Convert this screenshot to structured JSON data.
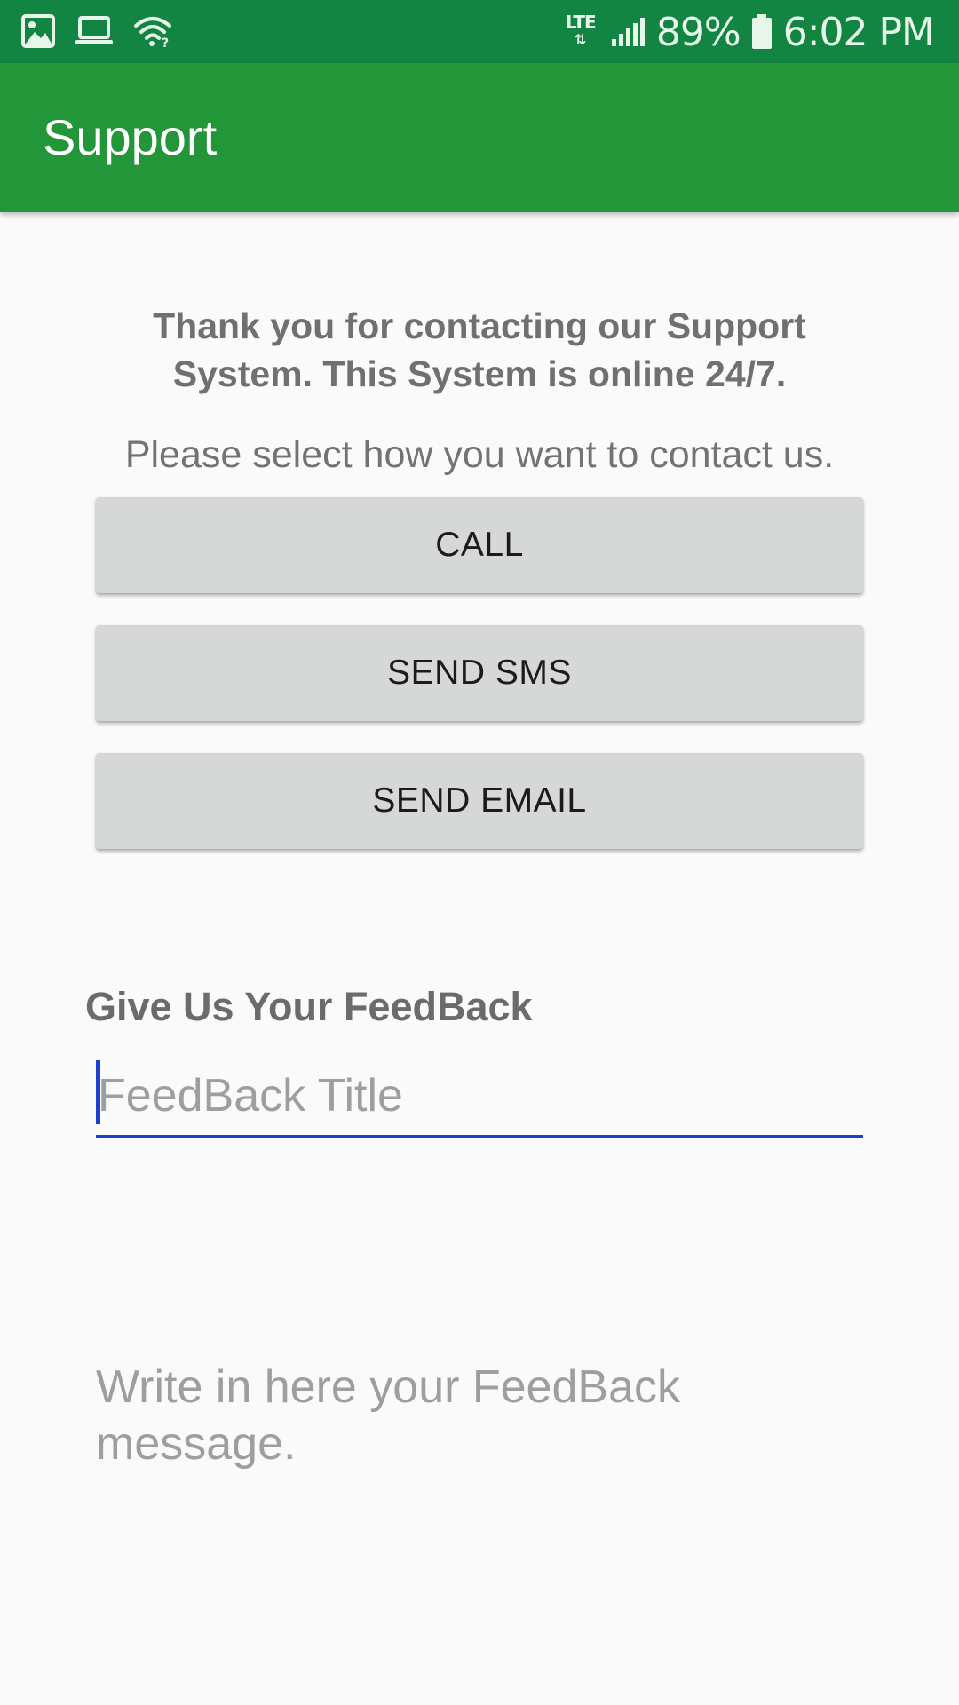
{
  "status_bar": {
    "left_icons": [
      "gallery-icon",
      "laptop-icon",
      "wifi-icon"
    ],
    "network_type": "LTE",
    "battery_percent": "89%",
    "time": "6:02 PM"
  },
  "app_bar": {
    "title": "Support"
  },
  "content": {
    "intro_text": "Thank you for contacting our Support System. This System is online 24/7.",
    "select_text": "Please select how you want to contact us.",
    "buttons": {
      "call": "CALL",
      "send_sms": "SEND SMS",
      "send_email": "SEND EMAIL"
    },
    "feedback": {
      "heading": "Give Us Your FeedBack",
      "title_value": "",
      "title_placeholder": "FeedBack Title",
      "message_value": "",
      "message_placeholder": "Write in here your FeedBack message."
    }
  },
  "colors": {
    "status_bar": "#138542",
    "app_bar": "#24963a",
    "button_bg": "#d6d7d7",
    "input_accent": "#1d3fcc"
  }
}
